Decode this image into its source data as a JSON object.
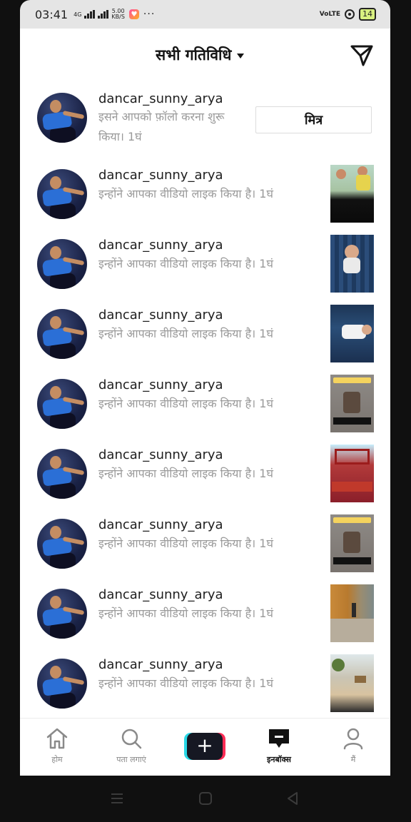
{
  "status_bar": {
    "time": "03:41",
    "network": "4G",
    "speed_value": "5.00",
    "speed_unit": "KB/S",
    "more": "···",
    "volte": "VoLTE",
    "battery": "14"
  },
  "header": {
    "title": "सभी गतिविधि",
    "dropdown_icon": "caret-down-icon",
    "action_icon": "send-icon"
  },
  "activities": [
    {
      "username": "dancar_sunny_arya",
      "text": "इसने आपको फ़ॉलो करना शुरू किया। 1घं",
      "button": "मित्र"
    },
    {
      "username": "dancar_sunny_arya",
      "text": "इन्होंने आपका वीडियो लाइक किया है। 1घं"
    },
    {
      "username": "dancar_sunny_arya",
      "text": "इन्होंने आपका वीडियो लाइक किया है। 1घं"
    },
    {
      "username": "dancar_sunny_arya",
      "text": "इन्होंने आपका वीडियो लाइक किया है। 1घं"
    },
    {
      "username": "dancar_sunny_arya",
      "text": "इन्होंने आपका वीडियो लाइक किया है। 1घं"
    },
    {
      "username": "dancar_sunny_arya",
      "text": "इन्होंने आपका वीडियो लाइक किया है। 1घं"
    },
    {
      "username": "dancar_sunny_arya",
      "text": "इन्होंने आपका वीडियो लाइक किया है। 1घं"
    },
    {
      "username": "dancar_sunny_arya",
      "text": "इन्होंने आपका वीडियो लाइक किया है। 1घं"
    },
    {
      "username": "dancar_sunny_arya",
      "text": "इन्होंने आपका वीडियो लाइक किया है। 1घं"
    }
  ],
  "bottom_nav": {
    "home": "होम",
    "discover": "पता लगाएं",
    "create": "+",
    "inbox": "इनबॉक्स",
    "me": "मैं"
  },
  "colors": {
    "accent_pink": "#fe2c55",
    "accent_cyan": "#29d8e6",
    "text_primary": "#161616",
    "text_secondary": "#9a9a9a"
  }
}
